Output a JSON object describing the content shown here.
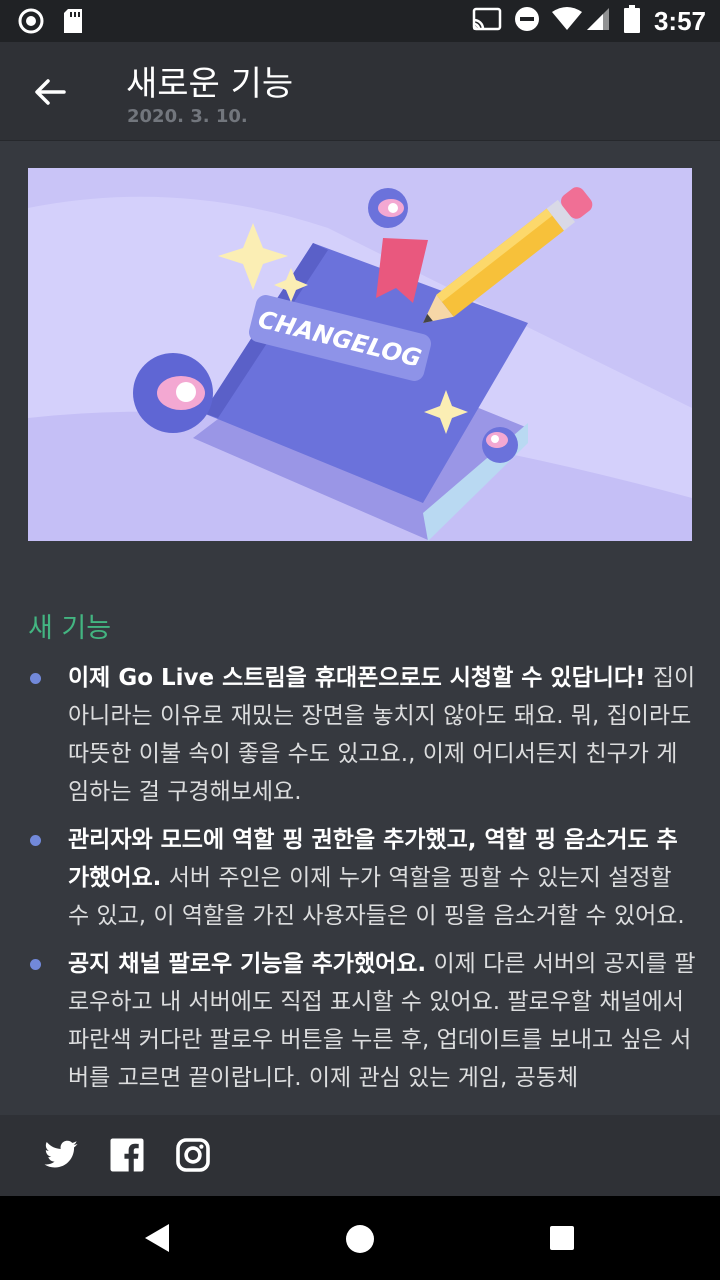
{
  "status_bar": {
    "time": "3:57",
    "left_icons": [
      "circle-status-icon",
      "sd-card-icon"
    ],
    "right_icons": [
      "cast-icon",
      "do-not-disturb-icon",
      "wifi-icon",
      "cell-signal-icon",
      "battery-icon"
    ]
  },
  "header": {
    "title": "새로운 기능",
    "date": "2020. 3. 10."
  },
  "hero": {
    "book_label": "CHANGELOG"
  },
  "section": {
    "title": "새 기능"
  },
  "features": [
    {
      "bold": "이제 Go Live 스트림을 휴대폰으로도 시청할 수 있답니다!",
      "text": " 집이 아니라는 이유로 재밌는 장면을 놓치지 않아도 돼요. 뭐, 집이라도 따뜻한 이불 속이 좋을 수도 있고요., 이제 어디서든지 친구가 게임하는 걸 구경해보세요."
    },
    {
      "bold": "관리자와 모드에 역할 핑 권한을 추가했고, 역할 핑 음소거도 추가했어요.",
      "text": " 서버 주인은 이제 누가 역할을 핑할 수 있는지 설정할 수 있고, 이 역할을 가진 사용자들은 이 핑을 음소거할 수 있어요."
    },
    {
      "bold": "공지 채널 팔로우 기능을 추가했어요.",
      "text": " 이제 다른 서버의 공지를 팔로우하고 내 서버에도 직접 표시할 수 있어요. 팔로우할 채널에서 파란색 커다란 팔로우 버튼을 누른 후, 업데이트를 보내고 싶은 서버를 고르면 끝이랍니다. 이제 관심 있는 게임, 공동체"
    }
  ],
  "social": [
    "twitter-icon",
    "facebook-icon",
    "instagram-icon"
  ],
  "colors": {
    "background": "#36393f",
    "header": "#2f3136",
    "accent_green": "#43b581",
    "bullet": "#7289da"
  }
}
